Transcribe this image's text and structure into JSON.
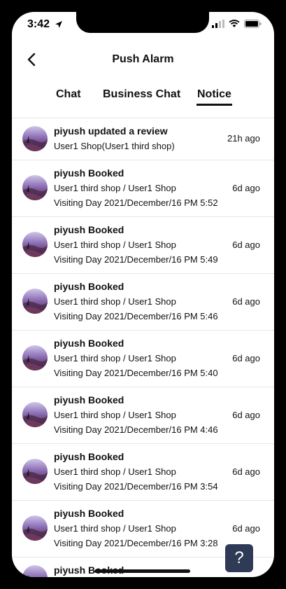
{
  "status": {
    "time": "3:42"
  },
  "header": {
    "title": "Push Alarm"
  },
  "tabs": [
    {
      "label": "Chat",
      "active": false
    },
    {
      "label": "Business Chat",
      "active": false
    },
    {
      "label": "Notice",
      "active": true
    }
  ],
  "notifications": [
    {
      "title": "piyush updated a review",
      "line1": "User1 Shop(User1 third shop)",
      "line2": "",
      "time": "21h ago"
    },
    {
      "title": "piyush Booked",
      "line1": "User1 third shop / User1 Shop",
      "line2": "Visiting Day 2021/December/16 PM 5:52",
      "time": "6d ago"
    },
    {
      "title": "piyush Booked",
      "line1": "User1 third shop / User1 Shop",
      "line2": "Visiting Day 2021/December/16 PM 5:49",
      "time": "6d ago"
    },
    {
      "title": "piyush Booked",
      "line1": "User1 third shop / User1 Shop",
      "line2": "Visiting Day 2021/December/16 PM 5:46",
      "time": "6d ago"
    },
    {
      "title": "piyush Booked",
      "line1": "User1 third shop / User1 Shop",
      "line2": "Visiting Day 2021/December/16 PM 5:40",
      "time": "6d ago"
    },
    {
      "title": "piyush Booked",
      "line1": "User1 third shop / User1 Shop",
      "line2": "Visiting Day 2021/December/16 PM 4:46",
      "time": "6d ago"
    },
    {
      "title": "piyush Booked",
      "line1": "User1 third shop / User1 Shop",
      "line2": "Visiting Day 2021/December/16 PM 3:54",
      "time": "6d ago"
    },
    {
      "title": "piyush Booked",
      "line1": "User1 third shop / User1 Shop",
      "line2": "Visiting Day 2021/December/16 PM 3:28",
      "time": "6d ago"
    },
    {
      "title": "piyush Booked",
      "line1": "",
      "line2": "",
      "time": ""
    }
  ],
  "help": {
    "label": "?"
  },
  "colors": {
    "help_bg": "#2f3a57",
    "divider": "#e6e6e6"
  }
}
